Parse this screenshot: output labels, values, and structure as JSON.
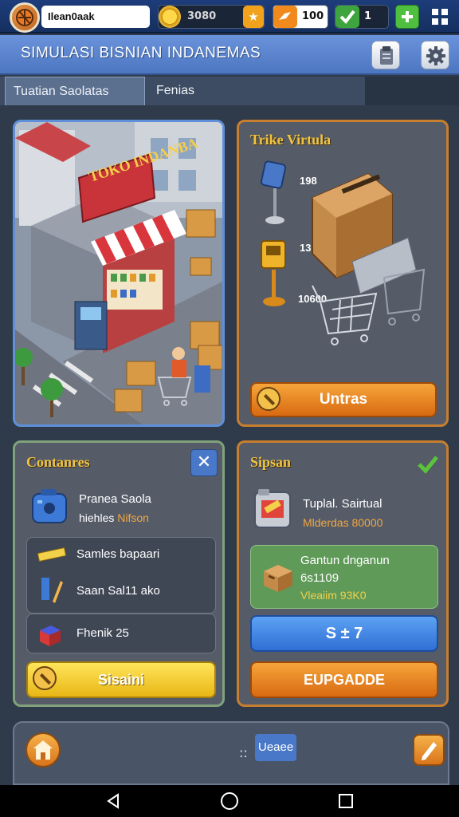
{
  "topbar": {
    "player_name": "Ilean0aak",
    "coins": "3080",
    "tickets": "100",
    "gems": "1",
    "coin_plus": "★"
  },
  "header": {
    "title": "SIMULASI BISNIAN INDANEMAS"
  },
  "tabs": [
    {
      "label": "Tuatian  Saolatas",
      "active": true
    },
    {
      "label": "Fenias",
      "active": false
    }
  ],
  "scene": {
    "store_sign": "TOKO INDANBA"
  },
  "trike_panel": {
    "title": "Trike Virtula",
    "stat_1": "198",
    "stat_2": "13230",
    "stat_3": "10600",
    "button_label": "Untras"
  },
  "containers_panel": {
    "title": "Contanres",
    "item_name": "Pranea Saola",
    "item_sub_a": "hiehles",
    "item_sub_b": "Nifson",
    "row_1": "Samles bapaari",
    "row_2": "Saan  Sal11 ako",
    "row_3": "Fhenik 25",
    "button_label": "Sisaini"
  },
  "shop_panel": {
    "title": "Sipsan",
    "item_name": "Tuplal. Sairtual",
    "item_sub": "Mlderdas 80000",
    "offer_line_1": "Gantun dnganun",
    "offer_line_2": "6s1109",
    "offer_line_3": "Vleaiim 93K0",
    "blue_button": "S ± 7",
    "upgrade_button": "EUPGADDE"
  },
  "bottom_bar": {
    "label_prefix": "::",
    "label": "Ueaee"
  },
  "colors": {
    "accent_blue": "#5e8fd8",
    "accent_orange": "#c77f2f",
    "title_yellow": "#f3c440"
  }
}
